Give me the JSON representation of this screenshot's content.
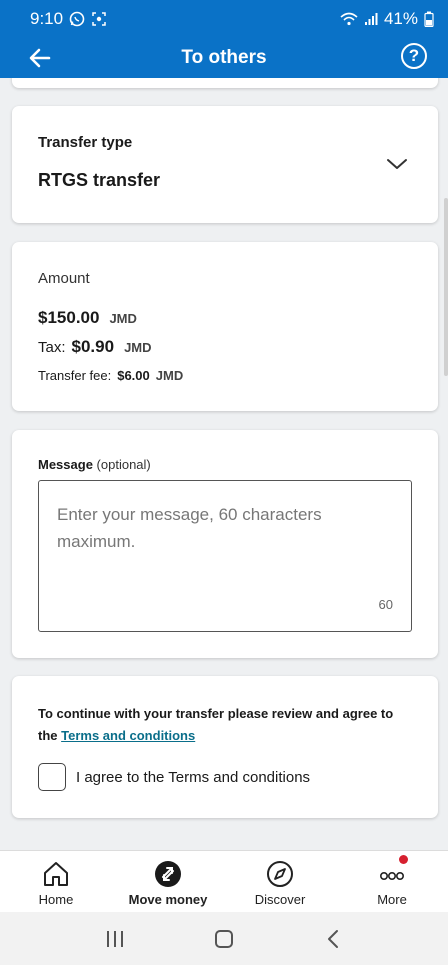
{
  "status_bar": {
    "time": "9:10",
    "battery": "41%"
  },
  "header": {
    "title": "To others"
  },
  "transfer_type": {
    "label": "Transfer type",
    "value": "RTGS transfer"
  },
  "amount": {
    "label": "Amount",
    "value": "$150.00",
    "currency": "JMD",
    "tax_label": "Tax:",
    "tax_value": "$0.90",
    "tax_currency": "JMD",
    "fee_label": "Transfer fee:",
    "fee_value": "$6.00",
    "fee_currency": "JMD"
  },
  "message": {
    "label": "Message",
    "optional": "(optional)",
    "placeholder": "Enter your message, 60 characters maximum.",
    "counter": "60"
  },
  "terms": {
    "text": "To continue with your transfer please review and agree to the",
    "link": "Terms and conditions",
    "checkbox_label": "I agree to the Terms and conditions"
  },
  "bottom_nav": {
    "home": "Home",
    "move_money": "Move money",
    "discover": "Discover",
    "more": "More"
  },
  "colors": {
    "brand": "#0a72c7",
    "link": "#0a6e8a",
    "badge": "#d6202f"
  }
}
